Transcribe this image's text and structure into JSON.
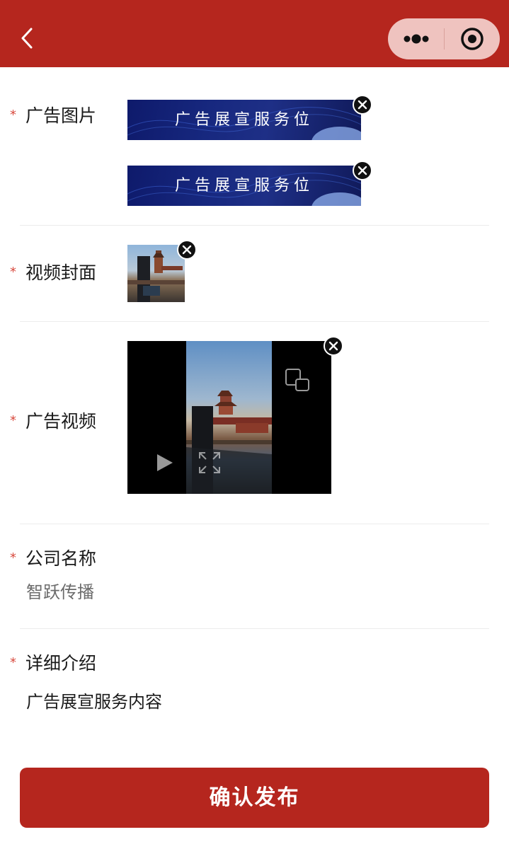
{
  "theme": {
    "primary": "#b5261e",
    "required_star": "#d84a3e"
  },
  "navbar": {
    "back_icon": "chevron-left-icon",
    "more_icon": "more-dots-icon",
    "close_icon": "target-circle-icon"
  },
  "ad_images": {
    "required_mark": "*",
    "label": "广告图片",
    "banners": [
      {
        "text": "广告展宣服务位"
      },
      {
        "text": "广告展宣服务位"
      }
    ]
  },
  "video_cover": {
    "required_mark": "*",
    "label": "视频封面"
  },
  "ad_video": {
    "required_mark": "*",
    "label": "广告视频",
    "controls": [
      "play-icon",
      "fullscreen-icon",
      "pip-icon"
    ]
  },
  "company": {
    "required_mark": "*",
    "label": "公司名称",
    "value": "智跃传播"
  },
  "detail": {
    "required_mark": "*",
    "label": "详细介绍",
    "value": "广告展宣服务内容"
  },
  "submit": {
    "label": "确认发布"
  }
}
